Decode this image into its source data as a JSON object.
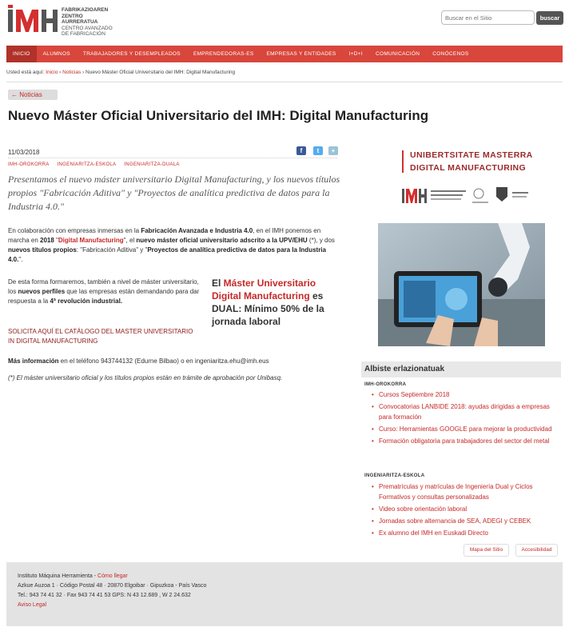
{
  "header": {
    "logo_text": "IMH",
    "logo_lines": [
      "FABRIKAZIOAREN",
      "ZENTRO AURRERATUA",
      "CENTRO AVANZADO",
      "DE FABRICACIÓN"
    ],
    "search_placeholder": "Buscar en el Sitio",
    "search_button": "buscar"
  },
  "nav": {
    "items": [
      "INICIO",
      "ALUMNOS",
      "TRABAJADORES Y DESEMPLEADOS",
      "EMPRENDEDORAS-ES",
      "EMPRESAS Y ENTIDADES",
      "I+D+I",
      "COMUNICACIÓN",
      "CONÓCENOS"
    ]
  },
  "breadcrumb": {
    "prefix": "Usted está aquí:",
    "home": "Inicio",
    "section": "Noticias",
    "current": "Nuevo Máster Oficial Universitario del IMH: Digital Manufacturing"
  },
  "back_link": "Noticias",
  "article": {
    "title": "Nuevo Máster Oficial Universitario del IMH: Digital Manufacturing",
    "date": "11/03/2018",
    "tags": [
      "IMH-OROKORRA",
      "INGENIARITZA-ESKOLA",
      "INGENIARITZA-DUALA"
    ],
    "lead": "Presentamos el nuevo máster universitario Digital Manufacturing, y los nuevos títulos propios \"Fabricación Aditiva\" y \"Proyectos de analítica predictiva de datos para la Industria 4.0.\"",
    "p1_a": "En colaboración con empresas inmersas en la ",
    "p1_b": "Fabricación Avanzada e Industria 4.0",
    "p1_c": ", en el IMH ponemos en marcha en ",
    "p1_d": "2018",
    "p1_e": " \"",
    "p1_f": "Digital Manufacturing",
    "p1_g": "\", el ",
    "p1_h": "nuevo máster oficial universitario adscrito a la UPV/EHU",
    "p1_i": " (*), y dos ",
    "p1_j": "nuevos títulos propios",
    "p1_k": ": \"Fabricación Aditiva\" y \"",
    "p1_l": "Proyectos de analítica predictiva de datos para la Industria 4.0.",
    "p1_m": "\".",
    "p2_a": "De esta forma formaremos, también a nivel de máster universitario, los ",
    "p2_b": "nuevos perfiles",
    "p2_c": " que las empresas están demandando para dar respuesta a la ",
    "p2_d": "4ª revolución industrial.",
    "p3": "SOLICITA AQUÍ EL CATÁLOGO DEL MASTER UNIVERSITARIO IN DIGITAL MANUFACTURING",
    "p4_a": "Más información",
    "p4_b": " en el teléfono 943744132 (Edurne Bilbao) o en ingeniaritza.ehu@imh.eus",
    "p5": "(*) El máster universitario oficial y los títulos propios están en trámite de aprobación por Unibasq.",
    "callout_a": "El ",
    "callout_b": "Máster Universitario Digital Manufacturing",
    "callout_c": " es DUAL: Mínimo 50% de la jornada laboral"
  },
  "sidebar": {
    "banner_line1": "UNIBERTSITATE MASTERRA",
    "banner_line2": "DIGITAL MANUFACTURING",
    "box_title": "Albiste erlazionatuak",
    "section1": "IMH-OROKORRA",
    "items1": [
      "Cursos Septiembre 2018",
      "Convocatorias LANBIDE 2018: ayudas dirigidas a empresas para formación",
      "Curso: Herramientas GOOGLE para mejorar la productividad",
      "Formación obligatoria para trabajadores del sector del metal"
    ],
    "section2": "INGENIARITZA-ESKOLA",
    "items2": [
      "Prematrículas y matrículas de Ingeniería Dual y Ciclos Formativos y consultas personalizadas",
      "Video sobre orientación laboral",
      "Jornadas sobre alternancia de SEA, ADEGI y CEBEK",
      "Ex alumno del IMH en Euskadi Directo"
    ],
    "site_map": "Mapa del Sitio",
    "accessibility": "Accesibilidad"
  },
  "footer": {
    "org": "Instituto Máquina Herramienta",
    "sep": " - ",
    "how_to": "Cómo llegar",
    "address": "Azkue Auzoa 1 · Código Postal 48 · 20870 Elgoibar · Gipuzkoa - País Vasco",
    "contact": "Tel.: 943 74 41 32 · Fax 943 74 41 53 GPS: N 43 12.689 , W 2 24.632",
    "legal": "Aviso Legal"
  }
}
